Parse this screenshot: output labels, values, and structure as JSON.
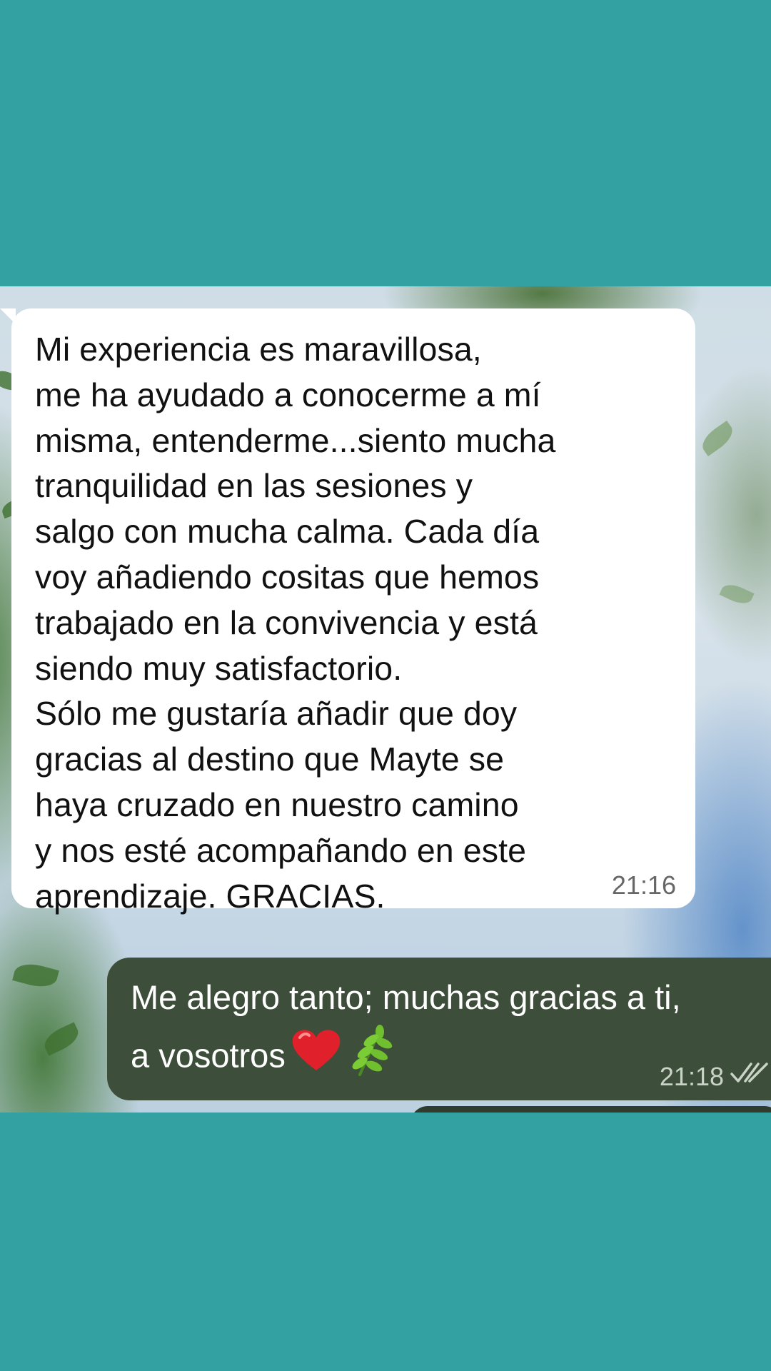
{
  "chat": {
    "incoming": {
      "text": "Mi experiencia es maravillosa,\nme ha ayudado a conocerme a mí\nmisma, entenderme...siento mucha\ntranquilidad en las sesiones y\nsalgo con mucha calma. Cada día\nvoy añadiendo cositas que hemos\ntrabajado en la convivencia y está\nsiendo muy satisfactorio.\nSólo me gustaría añadir que doy\ngracias al destino que Mayte se\nhaya cruzado en nuestro camino\ny nos esté acompañando en este\naprendizaje. GRACIAS.",
      "time": "21:16"
    },
    "outgoing": {
      "text": "Me alegro tanto; muchas gracias a ti,\na vosotros",
      "emojis": [
        "red-heart",
        "herb"
      ],
      "time": "21:18",
      "status_icon": "double-check-read-icon"
    }
  },
  "colors": {
    "page_background": "#33a0a1",
    "incoming_bubble": "#ffffff",
    "outgoing_bubble": "#3d4f3a"
  }
}
